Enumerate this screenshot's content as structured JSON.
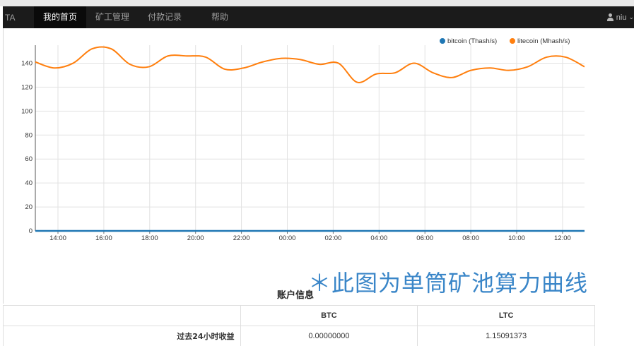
{
  "navbar": {
    "brand": "TA",
    "items": [
      {
        "label": "我的首页",
        "active": true
      },
      {
        "label": "矿工管理",
        "active": false
      },
      {
        "label": "付款记录",
        "active": false
      },
      {
        "label": "帮助",
        "active": false
      }
    ],
    "user": "niu",
    "user_icon": "user-icon",
    "caret_icon": "caret-down-icon"
  },
  "chart_data": {
    "type": "line",
    "legend_position": "top-right",
    "grid": true,
    "ylim": [
      0,
      155
    ],
    "yticks": [
      "0",
      "20",
      "40",
      "60",
      "80",
      "100",
      "120",
      "140"
    ],
    "xticks": [
      "14:00",
      "16:00",
      "18:00",
      "20:00",
      "22:00",
      "00:00",
      "02:00",
      "04:00",
      "06:00",
      "08:00",
      "10:00",
      "12:00"
    ],
    "series": [
      {
        "name": "bitcoin (Thash/s)",
        "color": "#1f77b4",
        "values": [
          0,
          0,
          0,
          0,
          0,
          0,
          0,
          0,
          0,
          0,
          0,
          0,
          0,
          0,
          0,
          0,
          0,
          0,
          0,
          0,
          0,
          0,
          0,
          0,
          0
        ]
      },
      {
        "name": "litecoin (Mhash/s)",
        "color": "#ff7f0e",
        "values": [
          141,
          136,
          140,
          152,
          152,
          139,
          137,
          146,
          146,
          145,
          135,
          136,
          141,
          144,
          143,
          139,
          140,
          124,
          131,
          132,
          140,
          132,
          128,
          134,
          136,
          134,
          137,
          145,
          145,
          137
        ]
      }
    ]
  },
  "annotation": "＊此图为单筒矿池算力曲线",
  "account": {
    "title": "账户信息",
    "headers": [
      "",
      "BTC",
      "LTC"
    ],
    "rows": [
      {
        "label": "过去24小时收益",
        "btc": "0.00000000",
        "ltc": "1.15091373"
      }
    ]
  }
}
